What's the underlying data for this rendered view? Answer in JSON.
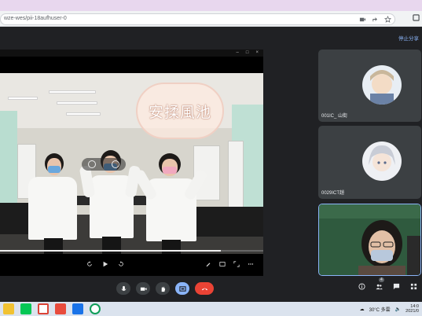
{
  "browser": {
    "url": "wze-wes/pii-18aufhuser-0",
    "toolbar_icons": [
      "camera-icon",
      "share-icon",
      "star-icon",
      "extension-icon",
      "puzzle-icon"
    ]
  },
  "meet": {
    "stop_sharing_label": "停止分享",
    "shared_overlay_text": "安揉風池",
    "scrub_progress": 0.84,
    "participants": [
      {
        "name": "001IC_ 山街",
        "avatar": "anime-boy-avatar"
      },
      {
        "name": "0029ICT趙",
        "avatar": "anime-girl-avatar"
      },
      {
        "name": "",
        "avatar": "camera-feed"
      }
    ],
    "controls": [
      "mic-icon",
      "camera-icon",
      "raise-hand-icon",
      "present-icon",
      "hangup-icon"
    ],
    "right_controls": [
      "info-icon",
      "people-icon",
      "chat-icon",
      "activities-icon"
    ],
    "people_count": "4"
  },
  "taskbar": {
    "apps": [
      "file-explorer-icon",
      "line-icon",
      "chrome-icon",
      "media-icon",
      "chrome-alt-icon"
    ],
    "weather": "30°C 多雲",
    "time": "14:0",
    "date": "2021/0"
  },
  "colors": {
    "accent": "#8ab4f8",
    "hangup": "#ea4335",
    "tab_strip": "#e8d7ee"
  }
}
